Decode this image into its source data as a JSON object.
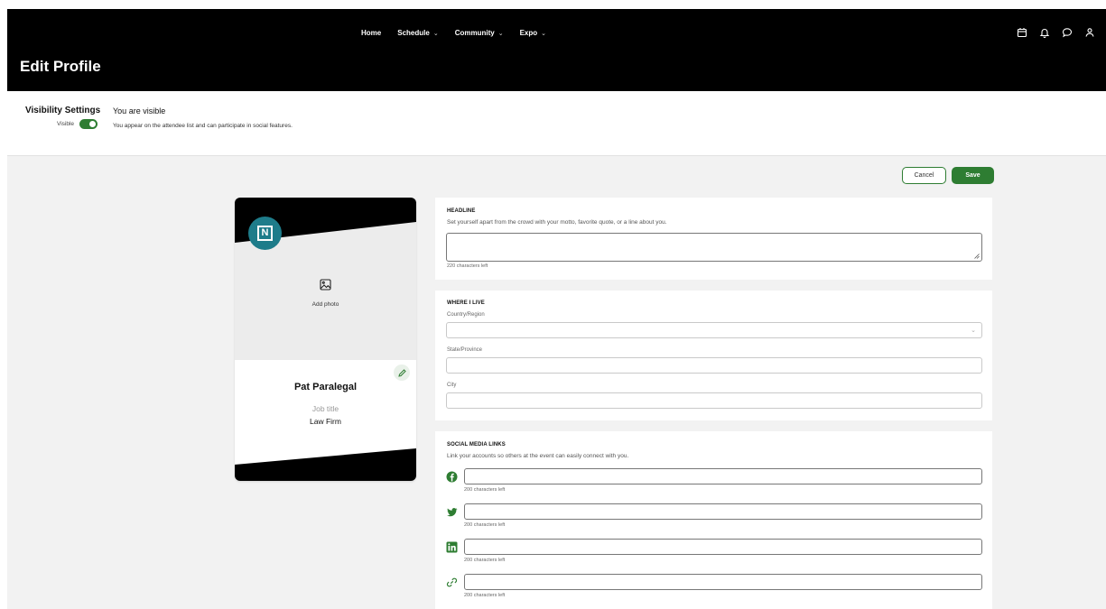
{
  "colors": {
    "header_bg": "#000000",
    "accent_green": "#2e7d32",
    "logo_teal": "#1e7c8a",
    "page_bg": "#f2f2f2"
  },
  "nav": {
    "items": [
      {
        "label": "Home",
        "has_dropdown": false
      },
      {
        "label": "Schedule",
        "has_dropdown": true
      },
      {
        "label": "Community",
        "has_dropdown": true
      },
      {
        "label": "Expo",
        "has_dropdown": true
      }
    ],
    "chevron": "⌄",
    "icons": [
      "calendar-icon",
      "bell-icon",
      "chat-icon",
      "user-icon"
    ]
  },
  "page": {
    "title": "Edit Profile"
  },
  "visibility": {
    "section_label": "Visibility Settings",
    "toggle_label": "Visible",
    "toggle_on": true,
    "status": "You are visible",
    "description": "You appear on the attendee list and can participate in social features."
  },
  "actions": {
    "cancel": "Cancel",
    "save": "Save"
  },
  "card": {
    "logo_letter": "N",
    "add_photo": "Add photo",
    "name": "Pat Paralegal",
    "job_title_placeholder": "Job title",
    "company": "Law Firm"
  },
  "headline": {
    "title": "HEADLINE",
    "description": "Set yourself apart from the crowd with your motto, favorite quote, or a line about you.",
    "value": "",
    "chars_left": "220 characters left"
  },
  "where": {
    "title": "WHERE I LIVE",
    "country_label": "Country/Region",
    "country_value": "",
    "state_label": "State/Province",
    "state_value": "",
    "city_label": "City",
    "city_value": ""
  },
  "social": {
    "title": "SOCIAL MEDIA LINKS",
    "description": "Link your accounts so others at the event can easily connect with you.",
    "links": [
      {
        "icon": "facebook-icon",
        "value": "",
        "chars_left": "200 characters left"
      },
      {
        "icon": "twitter-icon",
        "value": "",
        "chars_left": "200 characters left"
      },
      {
        "icon": "linkedin-icon",
        "value": "",
        "chars_left": "200 characters left"
      },
      {
        "icon": "link-icon",
        "value": "",
        "chars_left": "200 characters left"
      }
    ]
  }
}
